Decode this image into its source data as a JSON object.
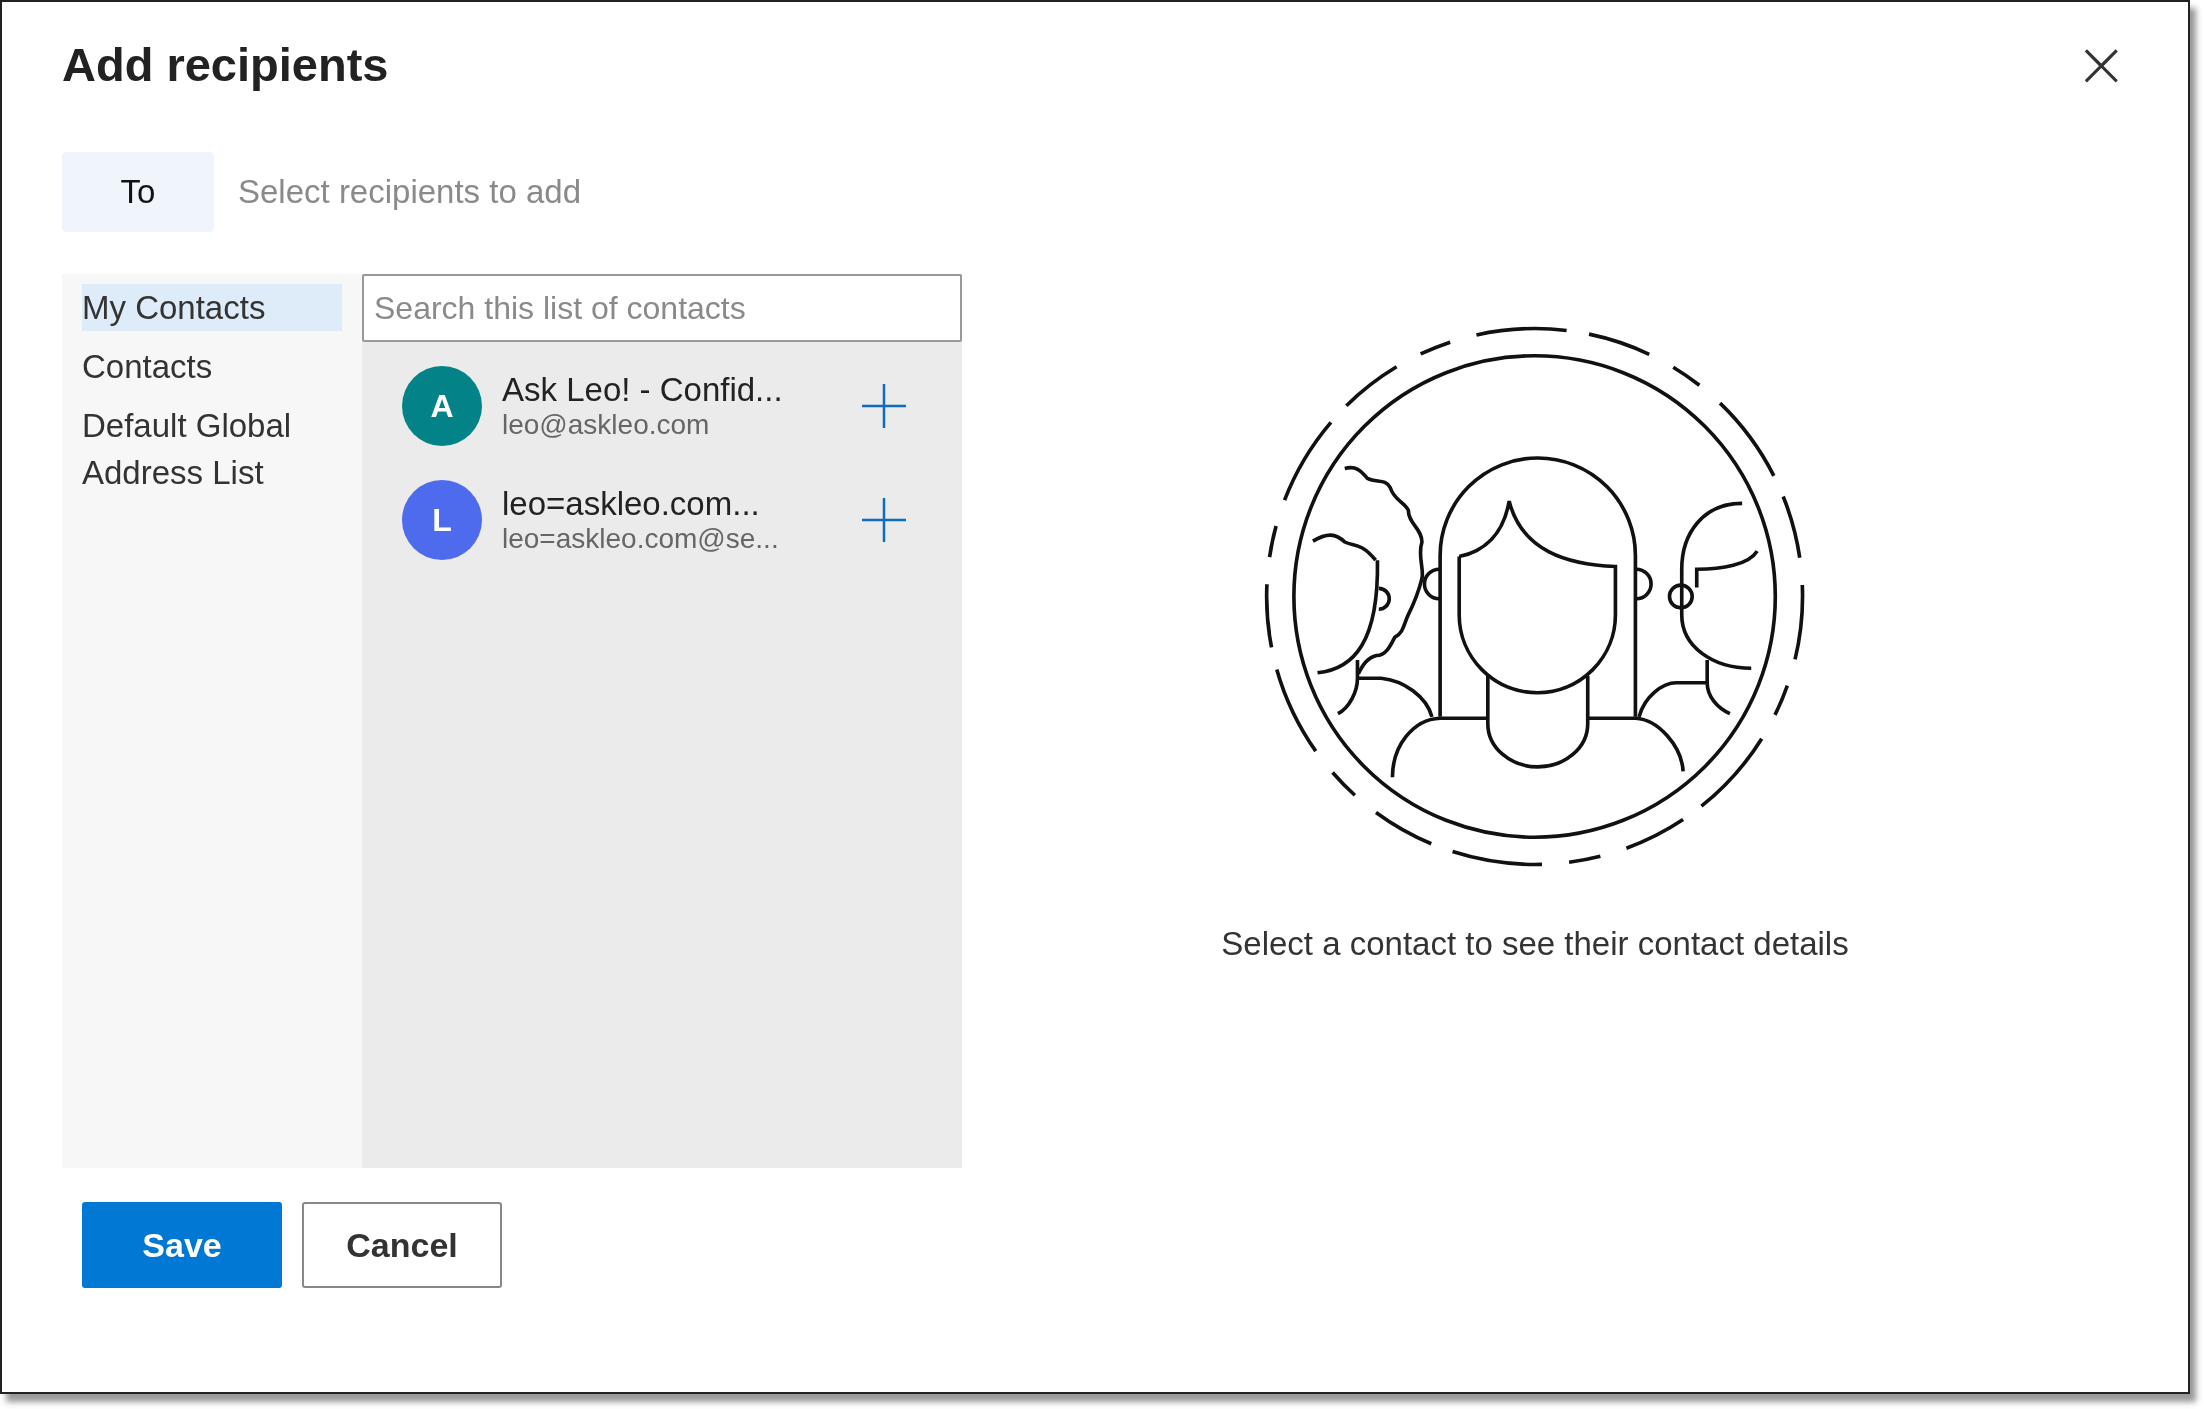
{
  "dialog": {
    "title": "Add recipients",
    "close": "×"
  },
  "recipients": {
    "label": "To",
    "placeholder": "Select recipients to add"
  },
  "sidebar": {
    "items": [
      {
        "label": "My Contacts",
        "selected": true
      },
      {
        "label": "Contacts",
        "selected": false
      },
      {
        "label": "Default Global Address List",
        "selected": false
      }
    ]
  },
  "search": {
    "placeholder": "Search this list of contacts"
  },
  "contacts": [
    {
      "initial": "A",
      "color": "#038387",
      "name": "Ask Leo! - Confid...",
      "email": "leo@askleo.com"
    },
    {
      "initial": "L",
      "color": "#4f6bed",
      "name": "leo=askleo.com...",
      "email": "leo=askleo.com@se..."
    }
  ],
  "details": {
    "message": "Select a contact to see their contact details"
  },
  "buttons": [
    {
      "label": "Save",
      "kind": "primary"
    },
    {
      "label": "Cancel",
      "kind": "secondary"
    }
  ]
}
